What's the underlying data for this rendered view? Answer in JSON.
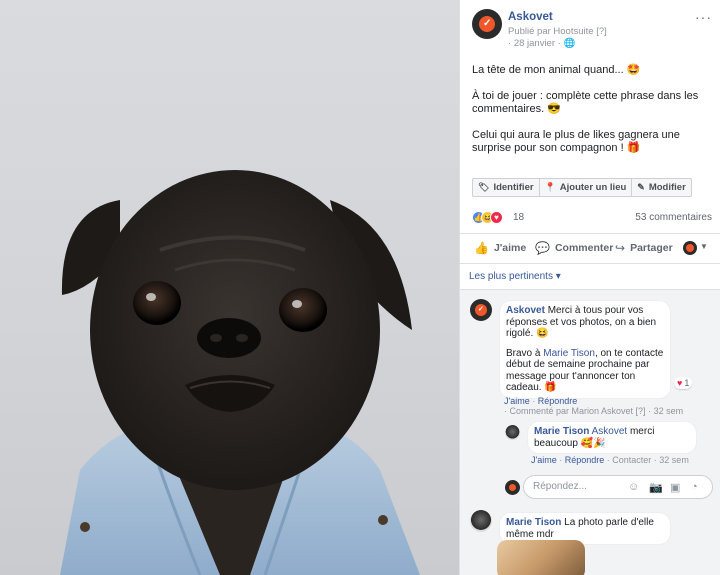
{
  "post": {
    "page_name": "Askovet",
    "published_by": "Publié par Hootsuite",
    "published_by_badge": "[?]",
    "date": "28 janvier",
    "more": "···",
    "text": {
      "line1": "La tête de mon animal quand... 🤩",
      "line2": "À toi de jouer : complète cette phrase dans les commentaires. 😎",
      "line3": "Celui qui aura le plus de likes gagnera une surprise pour son compagnon ! 🎁"
    },
    "tag_buttons": {
      "identify": "Identifier",
      "add_location": "Ajouter un lieu",
      "edit": "Modifier"
    },
    "reaction_count": "18",
    "comment_count": "53 commentaires",
    "actions": {
      "like": "J'aime",
      "comment": "Commenter",
      "share": "Partager"
    }
  },
  "comments": {
    "filter_label": "Les plus pertinents ▾",
    "items": [
      {
        "author": "Askovet",
        "text1": "Merci à tous pour vos réponses et vos photos, on a bien rigolé. 😆",
        "text2_prefix": "Bravo à ",
        "text2_mention": "Marie Tison",
        "text2_suffix": ", on te contacte début de semaine prochaine par message pour t'annoncer ton cadeau. 🎁",
        "reaction_count": "1",
        "like": "J'aime",
        "reply": "Répondre",
        "commented_by": "Commenté par Marion Askovet [?]",
        "time": "32 sem"
      },
      {
        "author": "Marie Tison",
        "mention": "Askovet",
        "text": " merci beaucoup 🥰🎉",
        "like": "J'aime",
        "reply": "Répondre",
        "contact": "Contacter",
        "time": "32 sem"
      },
      {
        "author": "Marie Tison",
        "text": " La photo parle d'elle même mdr"
      }
    ],
    "reply_placeholder": "Répondez..."
  },
  "colors": {
    "brand_orange": "#f0582b",
    "link_blue": "#385898",
    "like_blue": "#4b87f5",
    "love_red": "#f0284a"
  }
}
